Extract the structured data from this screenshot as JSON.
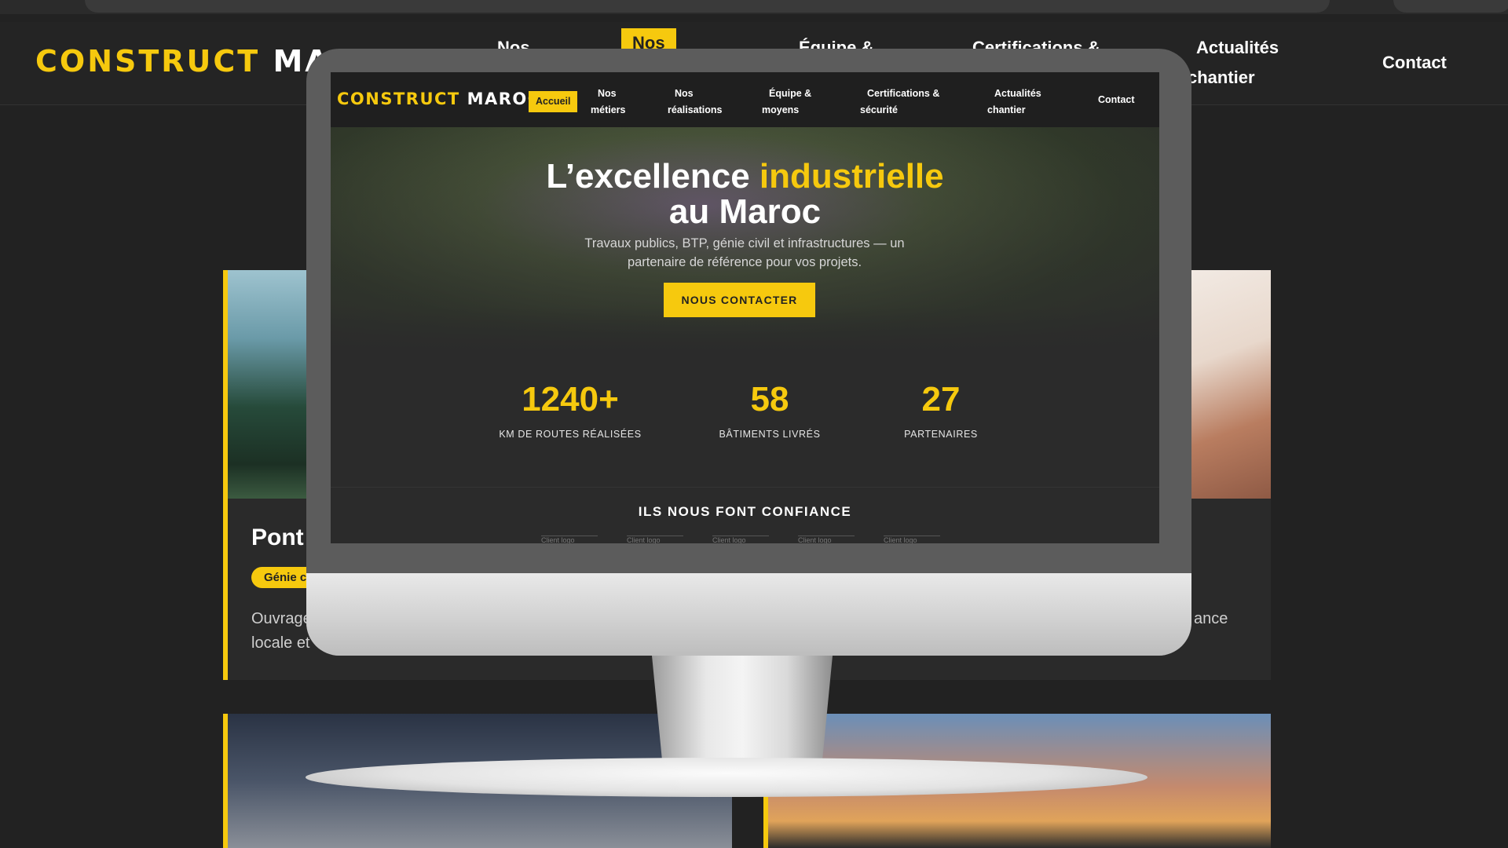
{
  "background_page": {
    "logo": {
      "part1": "CONSTRUCT",
      "part2": "MAR"
    },
    "nav": [
      {
        "label": "Nos"
      },
      {
        "label": "Nos"
      },
      {
        "label": "Équipe &"
      },
      {
        "label": "Certifications &"
      },
      {
        "label": "Actualités"
      },
      {
        "label": "chantier"
      },
      {
        "label": "Contact"
      }
    ],
    "card": {
      "title": "Pont",
      "tag": "Génie c",
      "text_line1": "Ouvrage",
      "text_line2": "locale et",
      "text_right": "ance"
    }
  },
  "site": {
    "logo": {
      "part1": "CONSTRUCT",
      "part2": "MAROC"
    },
    "nav": {
      "home": "Accueil",
      "metiers": {
        "l1": "Nos",
        "l2": "métiers"
      },
      "realisations": {
        "l1": "Nos",
        "l2": "réalisations"
      },
      "equipe": {
        "l1": "Équipe &",
        "l2": "moyens"
      },
      "certifications": {
        "l1": "Certifications &",
        "l2": "sécurité"
      },
      "actualites": {
        "l1": "Actualités",
        "l2": "chantier"
      },
      "contact": "Contact"
    },
    "hero": {
      "title_part1": "L’excellence ",
      "title_accent": "industrielle",
      "title_line2": "au Maroc",
      "subtitle": "Travaux publics, BTP, génie civil et infrastructures — un partenaire de référence pour vos projets.",
      "cta": "NOUS CONTACTER"
    },
    "stats": [
      {
        "value": "1240+",
        "label": "KM DE ROUTES RÉALISÉES"
      },
      {
        "value": "58",
        "label": "BÂTIMENTS LIVRÉS"
      },
      {
        "value": "27",
        "label": "PARTENAIRES"
      }
    ],
    "trust": {
      "title": "ILS NOUS FONT CONFIANCE",
      "logos": [
        "Client logo",
        "Client logo",
        "Client logo",
        "Client logo",
        "Client logo"
      ]
    }
  },
  "colors": {
    "accent": "#f6c90e",
    "dark": "#2b2b2b",
    "nav_bg": "#1f1f1f"
  }
}
